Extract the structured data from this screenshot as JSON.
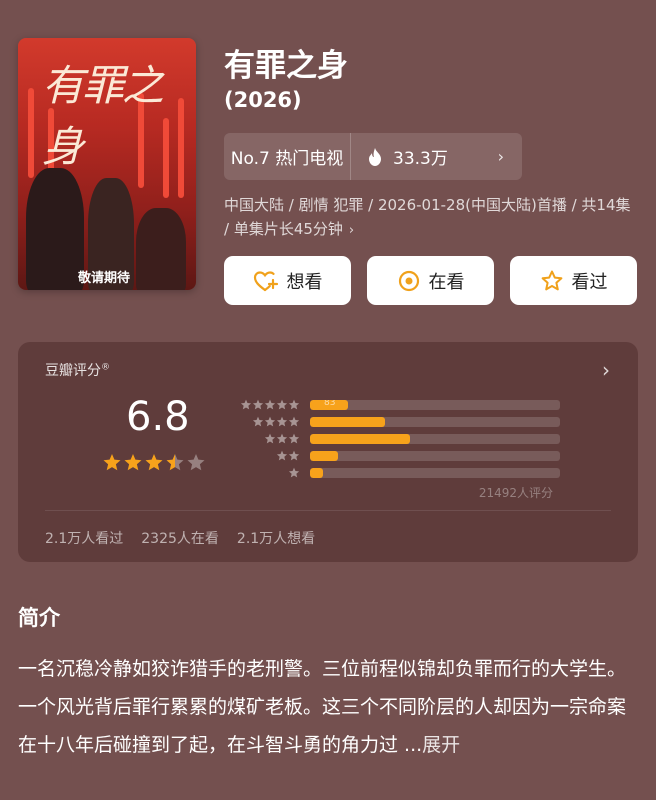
{
  "poster": {
    "title_art": "有罪之身",
    "tagline": "敬请期待"
  },
  "title": "有罪之身",
  "year": "(2026)",
  "rank": {
    "label": "No.7 热门电视",
    "heat": "33.3万",
    "chevron": "›"
  },
  "meta": {
    "line": "中国大陆 / 剧情 犯罪 / 2026-01-28(中国大陆)首播 / 共14集 / 单集片长45分钟",
    "chevron": "›"
  },
  "actions": [
    {
      "label": "想看",
      "icon": "heart-plus-icon"
    },
    {
      "label": "在看",
      "icon": "target-circle-icon"
    },
    {
      "label": "看过",
      "icon": "star-outline-icon"
    }
  ],
  "rating": {
    "label": "豆瓣评分",
    "mark": "®",
    "chevron": "›",
    "score": "6.8",
    "stars": 3.5,
    "distribution": [
      {
        "stars": 5,
        "fraction": 0.15,
        "tooltip": "83"
      },
      {
        "stars": 4,
        "fraction": 0.3
      },
      {
        "stars": 3,
        "fraction": 0.4
      },
      {
        "stars": 2,
        "fraction": 0.11
      },
      {
        "stars": 1,
        "fraction": 0.05
      }
    ],
    "count": "21492人评分",
    "stats": [
      "2.1万人看过",
      "2325人在看",
      "2.1万人想看"
    ]
  },
  "intro": {
    "title": "简介",
    "text": "一名沉稳冷静如狡诈猎手的老刑警。三位前程似锦却负罪而行的大学生。一个风光背后罪行累累的煤矿老板。这三个不同阶层的人却因为一宗命案在十八年后碰撞到了起，在斗智斗勇的角力过 ...",
    "expand": "展开"
  },
  "colors": {
    "background": "#74504f",
    "accent": "#f7a21b",
    "button_icon": "#f0a11b"
  }
}
